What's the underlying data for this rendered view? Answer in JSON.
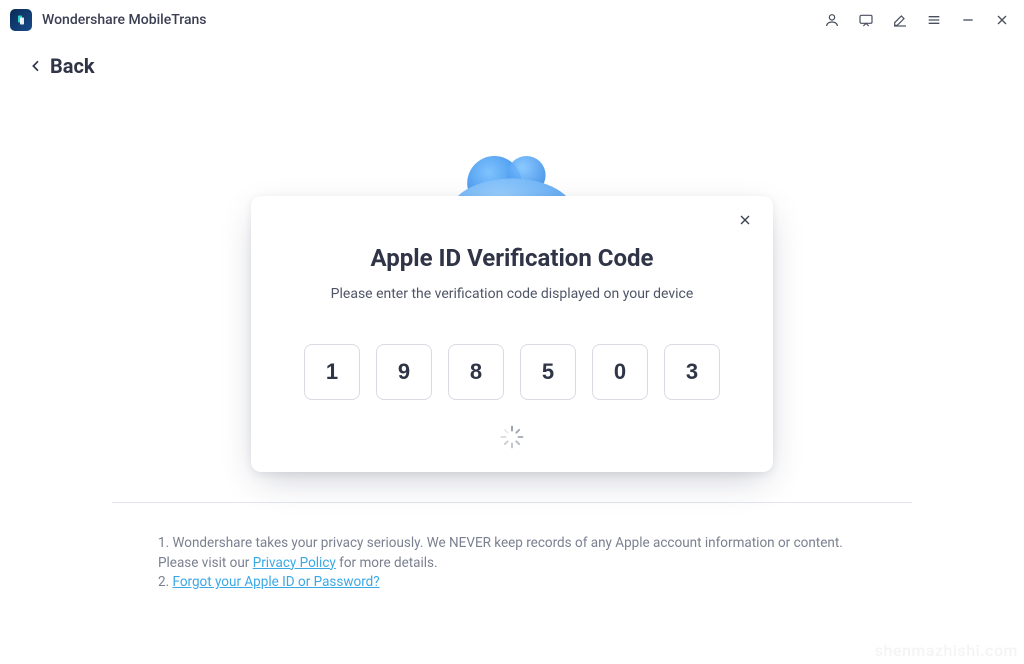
{
  "app": {
    "title": "Wondershare MobileTrans"
  },
  "back": {
    "label": "Back"
  },
  "modal": {
    "title": "Apple ID  Verification Code",
    "subtitle": "Please enter the verification code displayed on your device",
    "code": [
      "1",
      "9",
      "8",
      "5",
      "0",
      "3"
    ]
  },
  "notes": {
    "line1_prefix": "1. Wondershare takes your privacy seriously. We NEVER keep records of any Apple account information or content. Please visit our ",
    "line1_link": " Privacy Policy",
    "line1_suffix": " for more details.",
    "line2_prefix": "2. ",
    "line2_link": "Forgot your Apple ID or Password?"
  },
  "watermark": "shenmazhishi.com"
}
